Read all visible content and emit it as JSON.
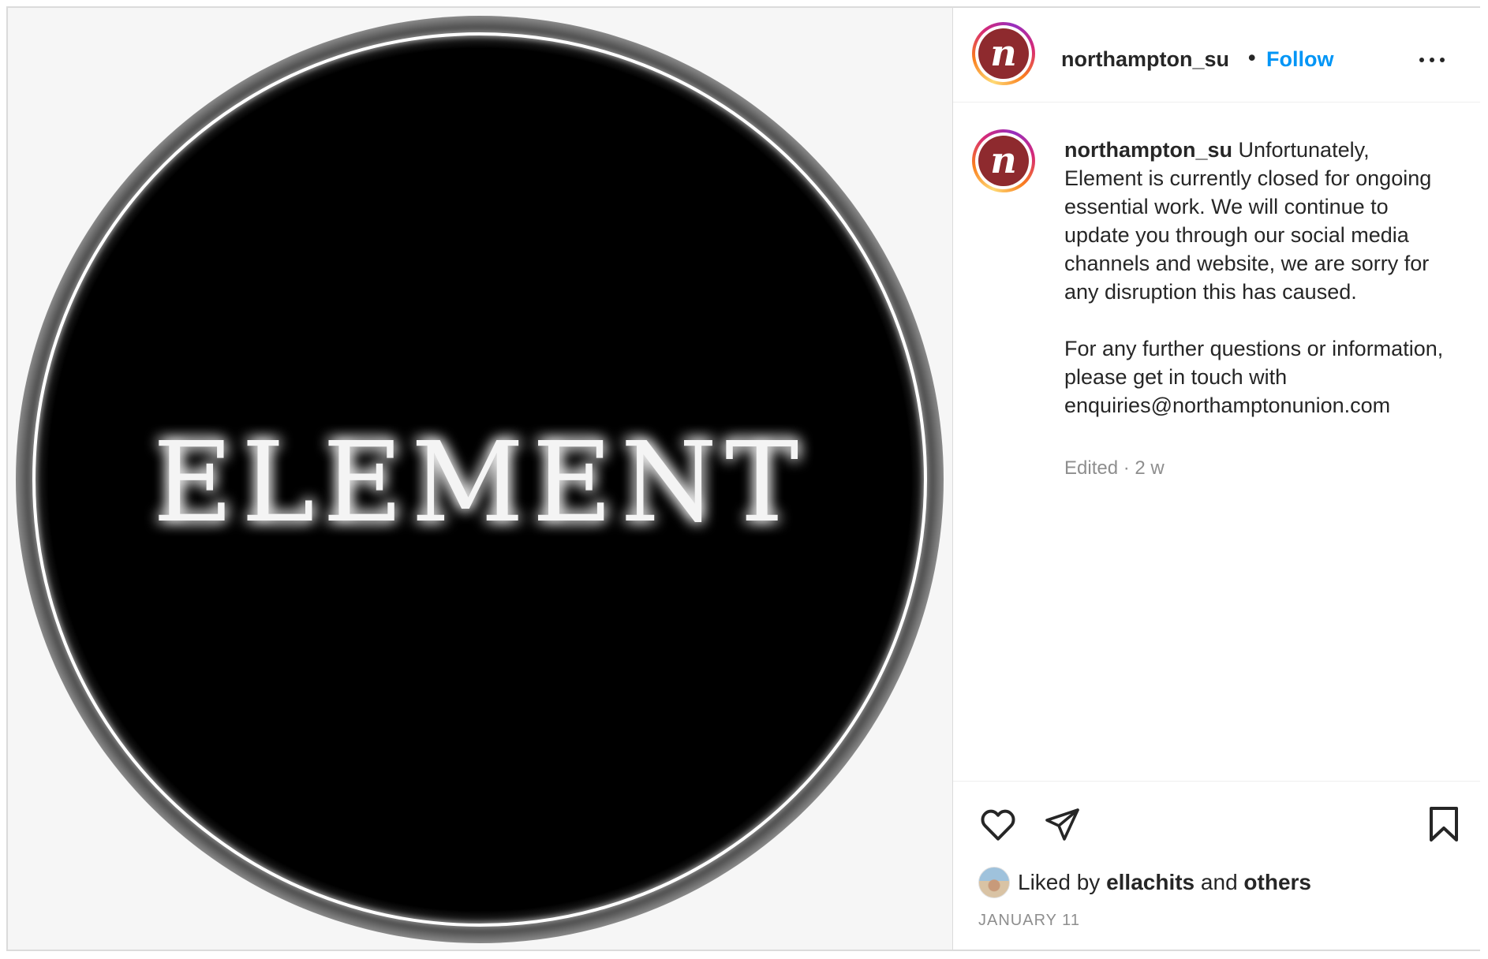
{
  "header": {
    "username": "northampton_su",
    "separator": "•",
    "follow_label": "Follow",
    "avatar_letter": "n"
  },
  "media": {
    "logo_text": "ELEMENT"
  },
  "caption": {
    "username": "northampton_su",
    "text": " Unfortunately, Element is currently closed for ongoing essential work. We will continue to update you through our social media channels and website, we are sorry for any disruption this has caused.\n\nFor any further questions or information, please get in touch with enquiries@northamptonunion.com",
    "edited": "Edited",
    "meta_sep": " · ",
    "age": "2 w"
  },
  "actions": {
    "like_icon": "heart-icon",
    "share_icon": "paper-plane-icon",
    "save_icon": "bookmark-icon"
  },
  "likes": {
    "prefix": "Liked by ",
    "user": "ellachits",
    "middle": " and ",
    "others": "others"
  },
  "date": "JANUARY 11",
  "colors": {
    "accent": "#0095f6",
    "avatar_bg": "#8e2a2e",
    "text": "#262626",
    "muted": "#8e8e8e"
  }
}
